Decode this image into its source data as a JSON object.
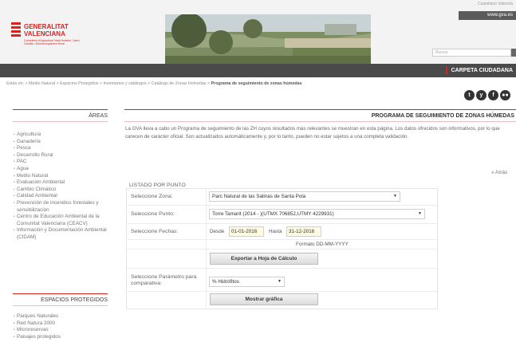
{
  "header": {
    "logo_line1": "GENERALITAT",
    "logo_line2": "VALENCIANA",
    "logo_small": "Conselleria d'Agricultura, Medi Ambient, Canvi Climàtic i Desenvolupament Rural",
    "top_links": "Castellano  Valencià",
    "gva_url": "www.gva.es",
    "search_placeholder": "Buscar",
    "carpeta": "CARPETA CIUDADANA"
  },
  "breadcrumb": {
    "prefix": "Estás en: > Medio Natural > Espacios Protegidos > Inventarios y catálogos > Catálogo de Zonas Húmedas >",
    "current": "Programa de seguimiento de zonas húmedas"
  },
  "social": [
    "t",
    "y",
    "f",
    "●●"
  ],
  "sidebar": {
    "areas_title": "ÁREAS",
    "areas": [
      "Agricultura",
      "Ganadería",
      "Pesca",
      "Desarrollo Rural",
      "PAC",
      "Agua",
      "Medio Natural",
      "Evaluación Ambiental",
      "Cambio Climático",
      "Calidad Ambiental",
      "Prevención de incendios forestales y sensibilización",
      "Centro de Educación Ambiental de la Comunitat Valenciana (CEACV)",
      "Información y Documentación Ambiental (CIDAM)"
    ],
    "espacios_title": "ESPACIOS PROTEGIDOS",
    "espacios": [
      "Parques Naturales",
      "Red Natura 2000",
      "Microreservas",
      "Paisajes protegidos"
    ]
  },
  "main": {
    "title": "PROGRAMA DE SEGUIMIENTO DE ZONAS HÚMEDAS",
    "intro": "La GVA lleva a cabo un Programa de seguimiento de las ZH cuyos resultados más relevantes se muestran en esta página. Los datos ofrecidos son informativos, por lo que carecen de carácter oficial. Son actualizados automáticamente y, por lo tanto, pueden no estar sujetos a una completa validación.",
    "back": "« Atrás",
    "listado": "LISTADO POR PUNTO",
    "zona_label": "Seleccione Zona:",
    "zona_value": "Parc Natural de las Salinas de Santa Pola",
    "punto_label": "Seleccione Punto:",
    "punto_value": "Torre Tamarit (2014 - )(UTMX 706852,UTMY 4229931)",
    "fechas_label": "Seleccione Fechas:",
    "desde": "Desde",
    "desde_value": "01-01-2016",
    "hasta": "Hasta",
    "hasta_value": "31-12-2016",
    "formato": "Formato DD-MM-YYYY",
    "export_btn": "Exportar a Hoja de Cálculo",
    "param_label": "Seleccione Parámetro para comparativa:",
    "param_value": "% Hidrófitos",
    "grafica_btn": "Mostrar gráfica"
  }
}
